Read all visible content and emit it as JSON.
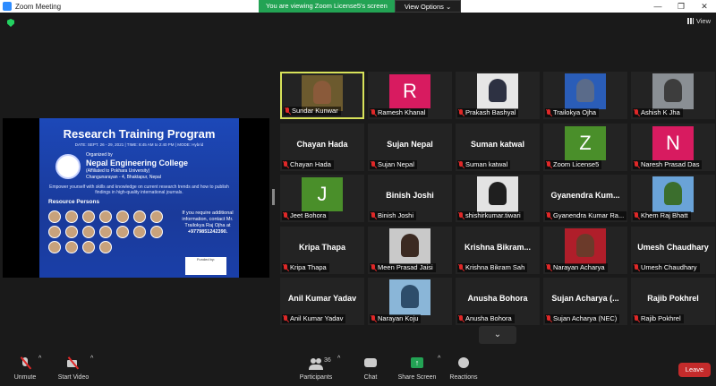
{
  "window": {
    "title": "Zoom Meeting"
  },
  "banner": {
    "viewing": "You are viewing Zoom License5's screen",
    "view_options": "View Options"
  },
  "view_button": {
    "label": "View"
  },
  "poster": {
    "title": "Research Training Program",
    "date_line": "DATE: SEPT. 26 - 29, 2021 | TIME: 8:45 AM to 2:40 PM | MODE: Hybrid",
    "organized_by": "Organized by",
    "college": "Nepal Engineering College",
    "affiliation": "(Affiliated to Pokhara University)",
    "address": "Changunarayan - 4, Bhaktapur, Nepal",
    "description": "Empower yourself with skills and knowledge on current research trends and how to publish findings in high-quality international journals.",
    "resource_persons": "Resource Persons",
    "contact_1": "If you require additional information, contact Mr. Trailokya Raj Ojha at",
    "contact_phone": "+9779851242390.",
    "funded_by": "Funded by:"
  },
  "participants": [
    {
      "label": "Sundar Kunwar",
      "type": "video",
      "skin": "#8a5a3a",
      "bg": "#6c5a2e",
      "active": true
    },
    {
      "label": "Ramesh Khanal",
      "type": "letter",
      "letter": "R",
      "color": "#d81b60"
    },
    {
      "label": "Prakash Bashyal",
      "type": "video",
      "skin": "#2d3142",
      "bg": "#e6e6e6"
    },
    {
      "label": "Trailokya Ojha",
      "type": "video",
      "skin": "#5a6b8a",
      "bg": "#2a5db8"
    },
    {
      "label": "Ashish K Jha",
      "type": "video",
      "skin": "#3d3d3d",
      "bg": "#8a8f94"
    },
    {
      "label": "Chayan Hada",
      "type": "name",
      "name": "Chayan Hada"
    },
    {
      "label": "Sujan Nepal",
      "type": "name",
      "name": "Sujan Nepal"
    },
    {
      "label": "Suman katwal",
      "type": "name",
      "name": "Suman katwal"
    },
    {
      "label": "Zoom License5",
      "type": "letter",
      "letter": "Z",
      "color": "#4a8f2a"
    },
    {
      "label": "Naresh Prasad Das",
      "type": "letter",
      "letter": "N",
      "color": "#d81b60"
    },
    {
      "label": "Jeet Bohora",
      "type": "letter",
      "letter": "J",
      "color": "#4a8f2a"
    },
    {
      "label": "Binish Joshi",
      "type": "name",
      "name": "Binish Joshi"
    },
    {
      "label": "shishirkumar.tiwari",
      "type": "video",
      "skin": "#1f1f1f",
      "bg": "#e3e3e3"
    },
    {
      "label": "Gyanendra Kumar Ra...",
      "type": "name",
      "name": "Gyanendra Kum..."
    },
    {
      "label": "Khem Raj Bhatt",
      "type": "video",
      "skin": "#3b6e2d",
      "bg": "#6aa3d8"
    },
    {
      "label": "Kripa Thapa",
      "type": "name",
      "name": "Kripa Thapa"
    },
    {
      "label": "Meen Prasad Jaisi",
      "type": "video",
      "skin": "#3b2a22",
      "bg": "#c9c9c9"
    },
    {
      "label": "Krishna Bikram Sah",
      "type": "name",
      "name": "Krishna Bikram..."
    },
    {
      "label": "Narayan Acharya",
      "type": "video",
      "skin": "#6b3a2a",
      "bg": "#b01e2a"
    },
    {
      "label": "Umesh Chaudhary",
      "type": "name",
      "name": "Umesh Chaudhary"
    },
    {
      "label": "Anil Kumar Yadav",
      "type": "name",
      "name": "Anil Kumar Yadav"
    },
    {
      "label": "Narayan Koju",
      "type": "video",
      "skin": "#2d4d6b",
      "bg": "#8ab6d8"
    },
    {
      "label": "Anusha Bohora",
      "type": "name",
      "name": "Anusha Bohora"
    },
    {
      "label": "Sujan Acharya (NEC)",
      "type": "name",
      "name": "Sujan Acharya (..."
    },
    {
      "label": "Rajib Pokhrel",
      "type": "name",
      "name": "Rajib Pokhrel"
    }
  ],
  "toolbar": {
    "unmute": "Unmute",
    "start_video": "Start Video",
    "participants": "Participants",
    "participants_count": "36",
    "chat": "Chat",
    "share_screen": "Share Screen",
    "reactions": "Reactions",
    "leave": "Leave"
  },
  "colors": {
    "share_green": "#23a354",
    "leave_red": "#c42b2b",
    "active_speaker": "#d7e25a"
  }
}
